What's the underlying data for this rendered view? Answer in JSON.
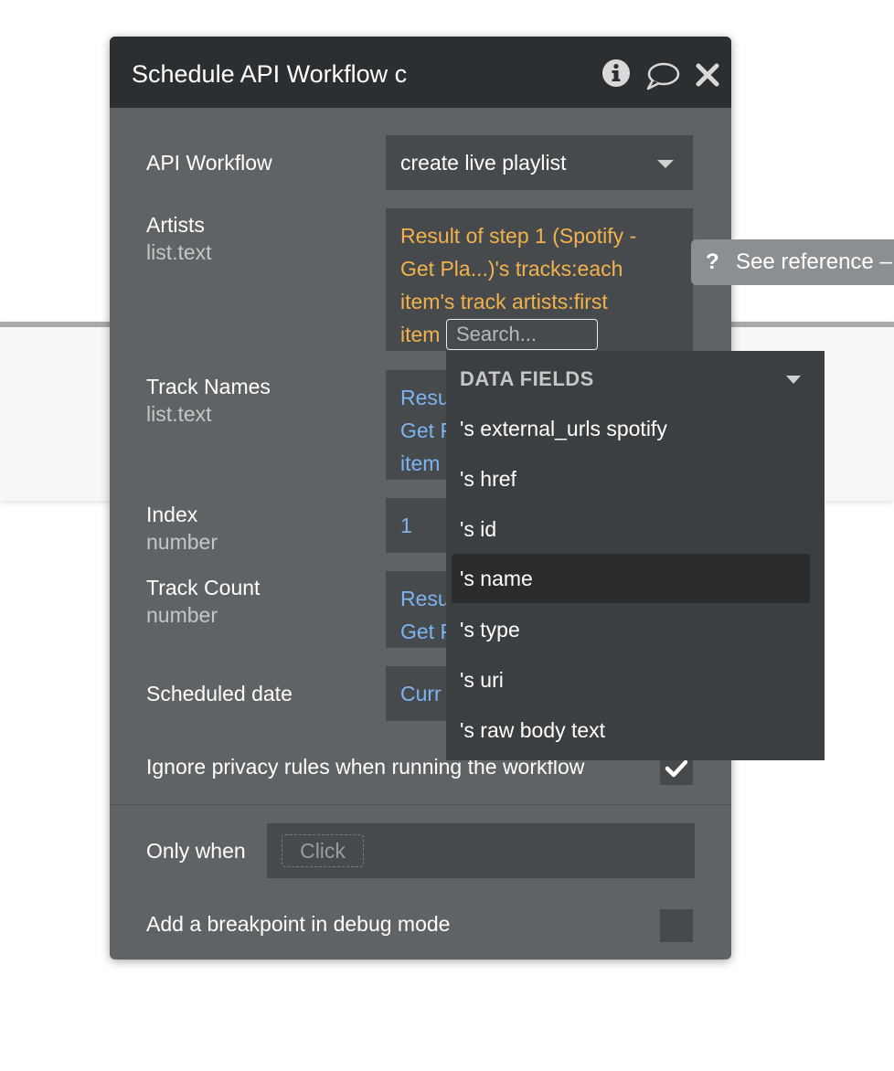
{
  "panel": {
    "title": "Schedule API Workflow c",
    "header_icons": [
      "info-icon",
      "comment-icon",
      "close-icon"
    ]
  },
  "fields": {
    "api_workflow": {
      "label": "API Workflow",
      "value": "create live playlist"
    },
    "artists": {
      "label": "Artists",
      "type": "list.text",
      "expression_lines": [
        "Result of step 1 (Spotify -",
        "Get Pla...)'s tracks:each",
        "item's track artists:first",
        "item"
      ]
    },
    "track_names": {
      "label": "Track Names",
      "type": "list.text",
      "value_lines": [
        "Resu",
        "Get P",
        "item"
      ]
    },
    "index": {
      "label": "Index",
      "type": "number",
      "value": "1"
    },
    "track_count": {
      "label": "Track Count",
      "type": "number",
      "value_lines": [
        "Resu",
        "Get P"
      ]
    },
    "scheduled_date": {
      "label": "Scheduled date",
      "value": "Curr"
    }
  },
  "privacy": {
    "label": "Ignore privacy rules when running the workflow",
    "checked": true
  },
  "only_when": {
    "label": "Only when",
    "placeholder": "Click"
  },
  "breakpoint": {
    "label": "Add a breakpoint in debug mode",
    "checked": false
  },
  "reference": {
    "icon": "question-icon",
    "label": "See reference –"
  },
  "dropdown": {
    "search_placeholder": "Search...",
    "section_title": "DATA FIELDS",
    "items": [
      "'s external_urls spotify",
      "'s href",
      "'s id",
      "'s name",
      "'s type",
      "'s uri",
      "'s raw body text"
    ],
    "selected_index": 3
  },
  "colors": {
    "panel_bg": "#5f6365",
    "header_bg": "#2b2f31",
    "field_bg": "#464a4c",
    "dropdown_bg": "#3c3f41",
    "expression_orange": "#f2b24c",
    "value_blue": "#7db4f0"
  }
}
